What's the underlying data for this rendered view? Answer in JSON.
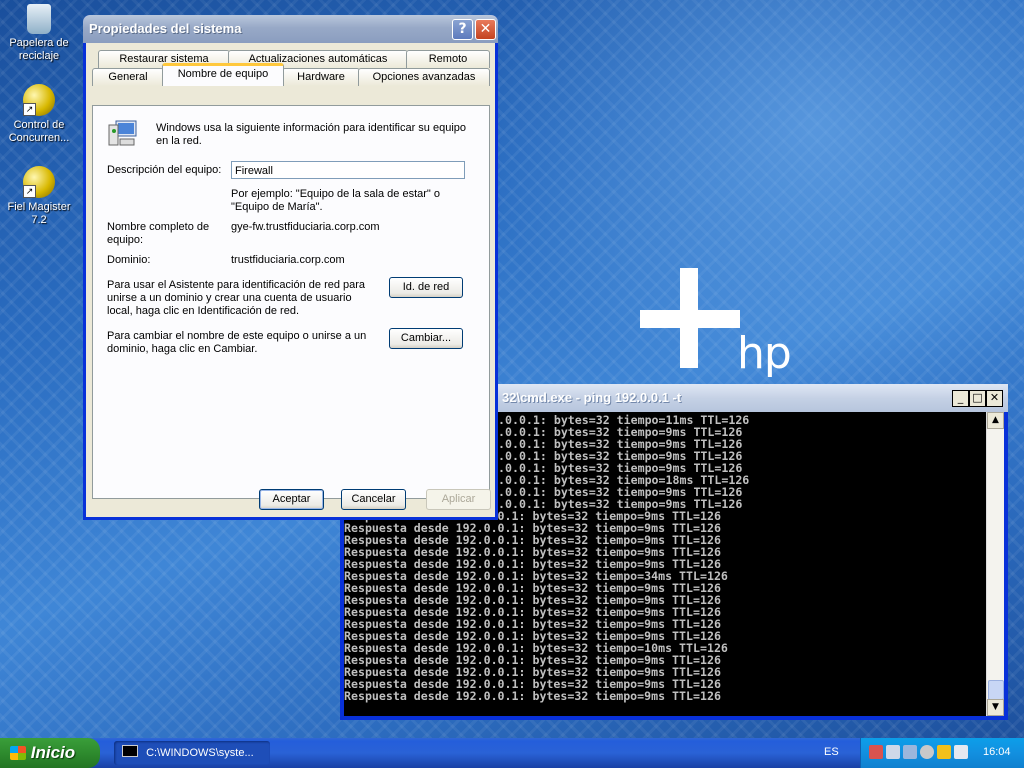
{
  "desktop": {
    "icons": [
      {
        "label": "Papelera de reciclaje"
      },
      {
        "label": "Control de Concurren..."
      },
      {
        "label": "Fiel Magister 7.2"
      }
    ],
    "brand": "hp"
  },
  "dialog": {
    "title": "Propiedades del sistema",
    "help_glyph": "?",
    "close_glyph": "✕",
    "tabs_row1": [
      "Restaurar sistema",
      "Actualizaciones automáticas",
      "Remoto"
    ],
    "tabs_row2": [
      "General",
      "Nombre de equipo",
      "Hardware",
      "Opciones avanzadas"
    ],
    "active_tab": "Nombre de equipo",
    "intro": "Windows usa la siguiente información para identificar su equipo en la red.",
    "description_label": "Descripción del equipo:",
    "description_value": "Firewall",
    "example_text": "Por ejemplo: \"Equipo de la sala de estar\" o \"Equipo de María\".",
    "fullname_label": "Nombre completo de equipo:",
    "fullname_value": "gye-fw.trustfiduciaria.corp.com",
    "domain_label": "Dominio:",
    "domain_value": "trustfiduciaria.corp.com",
    "netid_text": "Para usar el Asistente para identificación de red para unirse a un dominio y crear una cuenta de usuario local, haga clic en Identificación de red.",
    "netid_button": "Id. de red",
    "rename_text": "Para cambiar el nombre de este equipo o unirse a un dominio, haga clic en Cambiar.",
    "rename_button": "Cambiar...",
    "ok_button": "Aceptar",
    "cancel_button": "Cancelar",
    "apply_button": "Aplicar"
  },
  "console": {
    "title": "32\\cmd.exe - ping 192.0.0.1 -t",
    "min_glyph": "_",
    "max_glyph": "□",
    "close_glyph": "✕",
    "lines": [
      ".0.0.1: bytes=32 tiempo=11ms TTL=126",
      ".0.0.1: bytes=32 tiempo=9ms TTL=126",
      ".0.0.1: bytes=32 tiempo=9ms TTL=126",
      ".0.0.1: bytes=32 tiempo=9ms TTL=126",
      ".0.0.1: bytes=32 tiempo=9ms TTL=126",
      ".0.0.1: bytes=32 tiempo=18ms TTL=126",
      ".0.0.1: bytes=32 tiempo=9ms TTL=126",
      ".0.0.1: bytes=32 tiempo=9ms TTL=126",
      "Respuesta desde 192.0.0.1: bytes=32 tiempo=9ms TTL=126",
      "Respuesta desde 192.0.0.1: bytes=32 tiempo=9ms TTL=126",
      "Respuesta desde 192.0.0.1: bytes=32 tiempo=9ms TTL=126",
      "Respuesta desde 192.0.0.1: bytes=32 tiempo=9ms TTL=126",
      "Respuesta desde 192.0.0.1: bytes=32 tiempo=9ms TTL=126",
      "Respuesta desde 192.0.0.1: bytes=32 tiempo=34ms TTL=126",
      "Respuesta desde 192.0.0.1: bytes=32 tiempo=9ms TTL=126",
      "Respuesta desde 192.0.0.1: bytes=32 tiempo=9ms TTL=126",
      "Respuesta desde 192.0.0.1: bytes=32 tiempo=9ms TTL=126",
      "Respuesta desde 192.0.0.1: bytes=32 tiempo=9ms TTL=126",
      "Respuesta desde 192.0.0.1: bytes=32 tiempo=9ms TTL=126",
      "Respuesta desde 192.0.0.1: bytes=32 tiempo=10ms TTL=126",
      "Respuesta desde 192.0.0.1: bytes=32 tiempo=9ms TTL=126",
      "Respuesta desde 192.0.0.1: bytes=32 tiempo=9ms TTL=126",
      "Respuesta desde 192.0.0.1: bytes=32 tiempo=9ms TTL=126",
      "Respuesta desde 192.0.0.1: bytes=32 tiempo=9ms TTL=126"
    ]
  },
  "taskbar": {
    "start_label": "Inicio",
    "task_label": "C:\\WINDOWS\\syste...",
    "language": "ES",
    "clock": "16:04"
  }
}
